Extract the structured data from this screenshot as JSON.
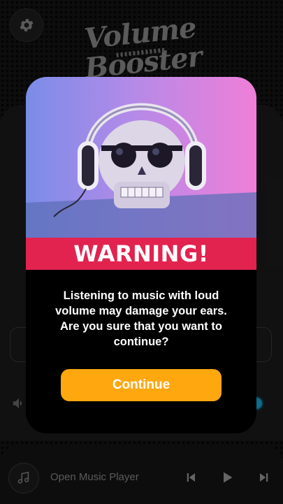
{
  "app": {
    "logo_line1": "Volume",
    "logo_line2": "Booster"
  },
  "icons": {
    "settings": "gear-icon",
    "speaker": "speaker-icon",
    "music": "music-note-icon",
    "previous": "skip-previous-icon",
    "play": "play-icon",
    "next": "skip-next-icon"
  },
  "player_bar": {
    "open_label": "Open Music Player"
  },
  "dialog": {
    "title": "WARNING!",
    "message": "Listening to music with loud volume may damage your ears. Are you sure that you want to continue?",
    "continue_label": "Continue"
  },
  "colors": {
    "warning_band": "#e2234f",
    "continue_button": "#ffa70f",
    "knob_accent": "#1aa6d6"
  }
}
